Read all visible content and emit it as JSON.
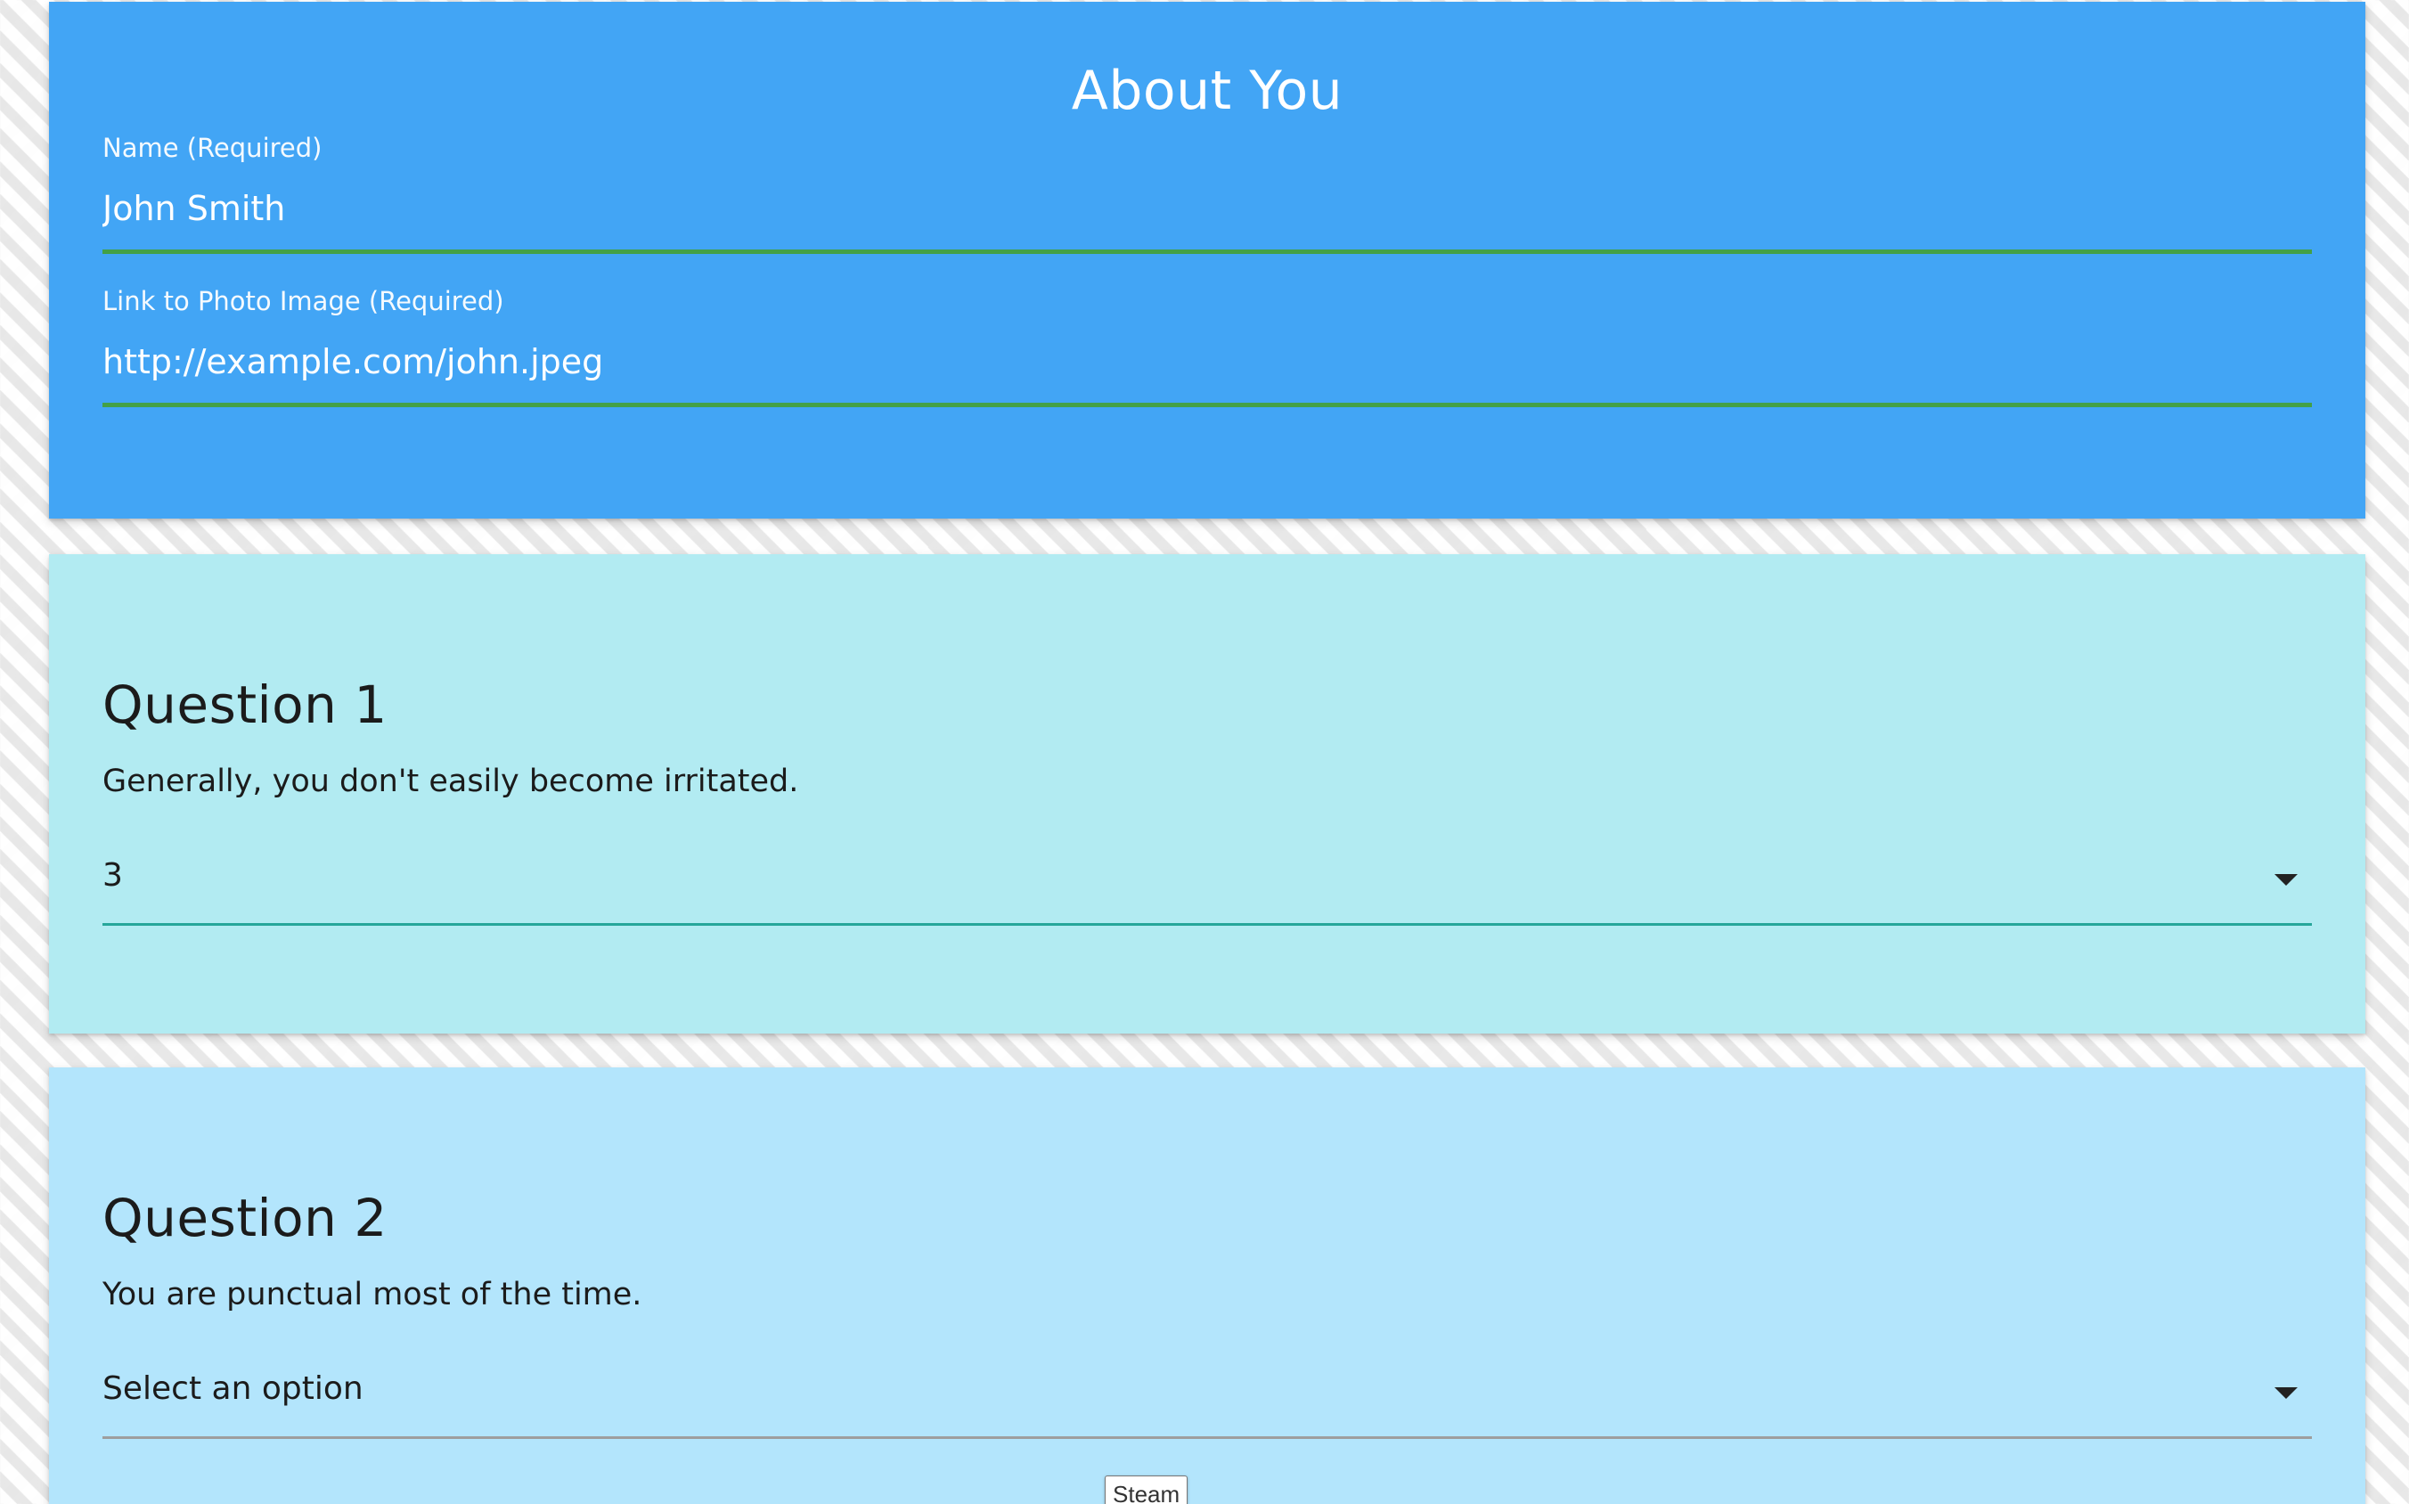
{
  "about": {
    "title": "About You",
    "name_label": "Name (Required)",
    "name_value": "John Smith",
    "photo_label": "Link to Photo Image (Required)",
    "photo_value": "http://example.com/john.jpeg"
  },
  "questions": [
    {
      "title": "Question 1",
      "text": "Generally, you don't easily become irritated.",
      "selected": "3"
    },
    {
      "title": "Question 2",
      "text": "You are punctual most of the time.",
      "selected": "Select an option"
    }
  ],
  "tooltip": {
    "text": "Steam"
  },
  "icons": {
    "dropdown": "dropdown-arrow-icon"
  },
  "colors": {
    "about_background": "#42a5f5",
    "question1_background": "#b2ebf2",
    "question2_background": "#b3e5fc",
    "valid_underline": "#43a047",
    "active_select_underline": "#26a69a"
  }
}
